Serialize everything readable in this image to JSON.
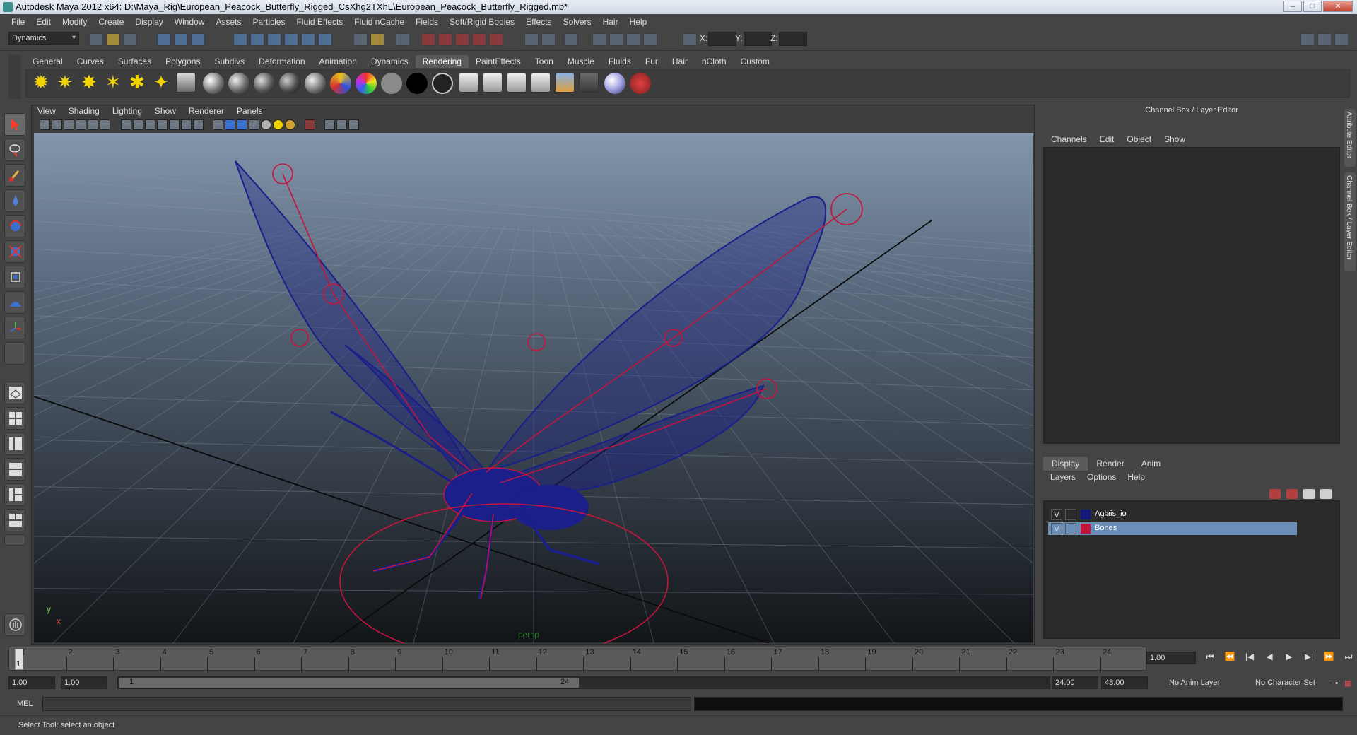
{
  "window": {
    "title": "Autodesk Maya 2012 x64: D:\\Maya_Rig\\European_Peacock_Butterfly_Rigged_CsXhg2TXhL\\European_Peacock_Butterfly_Rigged.mb*"
  },
  "menubar": [
    "File",
    "Edit",
    "Modify",
    "Create",
    "Display",
    "Window",
    "Assets",
    "Particles",
    "Fluid Effects",
    "Fluid nCache",
    "Fields",
    "Soft/Rigid Bodies",
    "Effects",
    "Solvers",
    "Hair",
    "Help"
  ],
  "statusline": {
    "mode": "Dynamics",
    "x_label": "X:",
    "y_label": "Y:",
    "z_label": "Z:"
  },
  "shelf": {
    "tabs": [
      "General",
      "Curves",
      "Surfaces",
      "Polygons",
      "Subdivs",
      "Deformation",
      "Animation",
      "Dynamics",
      "Rendering",
      "PaintEffects",
      "Toon",
      "Muscle",
      "Fluids",
      "Fur",
      "Hair",
      "nCloth",
      "Custom"
    ],
    "active_tab": "Rendering"
  },
  "viewport": {
    "menu": [
      "View",
      "Shading",
      "Lighting",
      "Show",
      "Renderer",
      "Panels"
    ],
    "camera": "persp",
    "axis_y": "y",
    "axis_x": "x"
  },
  "channel_box": {
    "title": "Channel Box / Layer Editor",
    "menu": [
      "Channels",
      "Edit",
      "Object",
      "Show"
    ]
  },
  "layer_editor": {
    "tabs": [
      "Display",
      "Render",
      "Anim"
    ],
    "menu": [
      "Layers",
      "Options",
      "Help"
    ],
    "layers": [
      {
        "visible": "V",
        "name": "Aglais_io",
        "color": "#101a7a"
      },
      {
        "visible": "V",
        "name": "Bones",
        "color": "#c4143c"
      }
    ]
  },
  "side_tabs": [
    "Attribute Editor",
    "Channel Box / Layer Editor"
  ],
  "time_slider": {
    "ticks": [
      "1",
      "2",
      "3",
      "4",
      "5",
      "6",
      "7",
      "8",
      "9",
      "10",
      "11",
      "12",
      "13",
      "14",
      "15",
      "16",
      "17",
      "18",
      "19",
      "20",
      "21",
      "22",
      "23",
      "24"
    ],
    "current_frame": "1",
    "frame_field": "1.00"
  },
  "range_slider": {
    "start_time": "1.00",
    "playback_start": "1.00",
    "range_start": "1",
    "range_end": "24",
    "playback_end": "24.00",
    "end_time": "48.00",
    "anim_layer": "No Anim Layer",
    "character_set": "No Character Set"
  },
  "command_line": {
    "label": "MEL"
  },
  "help_line": {
    "text": "Select Tool: select an object"
  },
  "colors": {
    "wire": "#1a1f8a",
    "bones": "#c4143c",
    "layer_highlight": "#6a8eb8"
  }
}
